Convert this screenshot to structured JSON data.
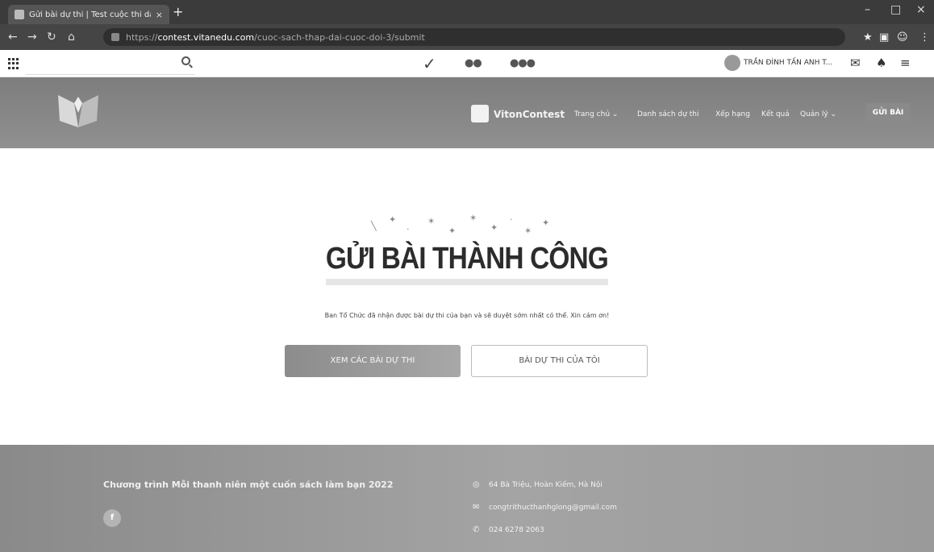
{
  "browser": {
    "tab_title": "Gửi bài dự thi | Test cuộc thi dai",
    "tab_close": "×",
    "new_tab": "+",
    "url_scheme": "https://",
    "url_host": "contest.vitanedu.com",
    "url_path": "/cuoc-sach-thap-dai-cuoc-doi-3/submit",
    "window_controls": [
      "–",
      "□",
      "×"
    ]
  },
  "site_bar": {
    "user_name": "TRẦN ĐÌNH TẤN ANH T..."
  },
  "nav": {
    "brand": "VitonContest",
    "items": [
      "Trang chủ ⌄",
      "Danh sách dự thi",
      "Xếp hạng",
      "Kết quả",
      "Quản lý ⌄"
    ],
    "submit_label": "GỬI BÀI"
  },
  "main": {
    "headline": "GỬI BÀI THÀNH CÔNG",
    "message": "Ban Tổ Chức đã nhận được bài dự thi của bạn và sẽ duyệt sớm nhất có thể. Xin cảm ơn!",
    "primary_button": "XEM CÁC BÀI DỰ THI",
    "secondary_button": "BÀI DỰ THI CỦA TÔI"
  },
  "footer": {
    "program_title": "Chương trình Mỗi thanh niên một cuốn sách làm bạn 2022",
    "facebook": "f",
    "address": "64 Bà Triệu, Hoàn Kiếm, Hà Nội",
    "email": "congtrithucthanhglong@gmail.com",
    "phone": "024 6278 2063"
  },
  "colors": {
    "hero_bg": "#858585",
    "footer_bg": "#9a9a9a",
    "headline": "#2c2c2c"
  }
}
